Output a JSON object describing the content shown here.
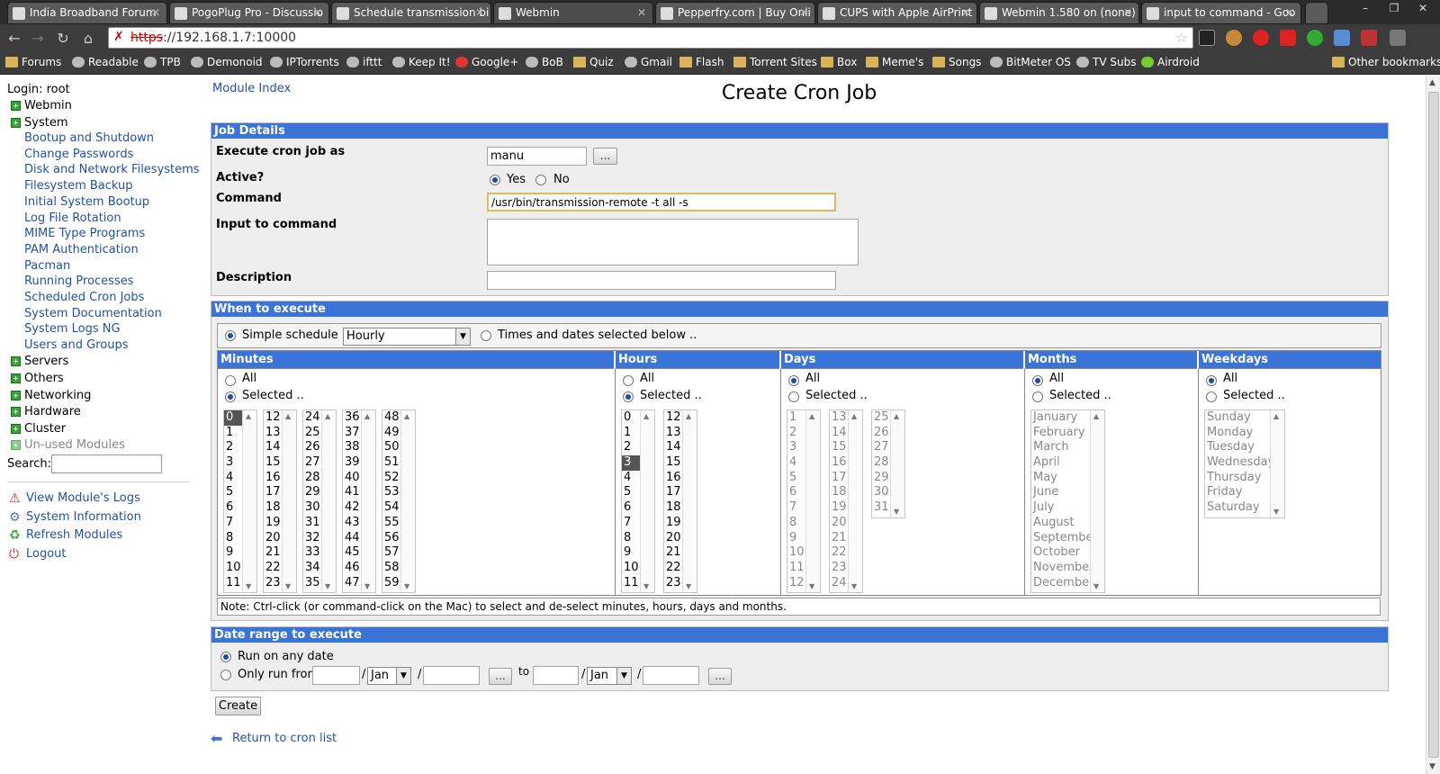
{
  "browser": {
    "tabs": [
      {
        "title": "India Broadband Forum",
        "active": false
      },
      {
        "title": "PogoPlug Pro - Discussio",
        "active": false
      },
      {
        "title": "Schedule transmission bi",
        "active": false
      },
      {
        "title": "Webmin",
        "active": true
      },
      {
        "title": "Pepperfry.com | Buy Onli",
        "active": false
      },
      {
        "title": "CUPS with Apple AirPrint",
        "active": false
      },
      {
        "title": "Webmin 1.580 on (none)",
        "active": false
      },
      {
        "title": "input to command - Goo",
        "active": false
      }
    ],
    "url_scheme": "https",
    "url_rest": "://192.168.1.7:10000",
    "bookmarks": [
      "Forums",
      "Readable",
      "TPB",
      "Demonoid",
      "IPTorrents",
      "ifttt",
      "Keep It!",
      "Google+",
      "BoB",
      "Quiz",
      "Gmail",
      "Flash",
      "Torrent Sites",
      "Box",
      "Meme's",
      "Songs",
      "BitMeter OS",
      "TV Subs",
      "Airdroid"
    ],
    "other_bookmarks": "Other bookmarks"
  },
  "sidebar": {
    "login": "Login: root",
    "categories_top": [
      "Webmin",
      "System"
    ],
    "system_modules": [
      "Bootup and Shutdown",
      "Change Passwords",
      "Disk and Network Filesystems",
      "Filesystem Backup",
      "Initial System Bootup",
      "Log File Rotation",
      "MIME Type Programs",
      "PAM Authentication",
      "Pacman",
      "Running Processes",
      "Scheduled Cron Jobs",
      "System Documentation",
      "System Logs NG",
      "Users and Groups"
    ],
    "categories_bottom": [
      "Servers",
      "Others",
      "Networking",
      "Hardware",
      "Cluster",
      "Un-used Modules"
    ],
    "search_label": "Search:",
    "actions": [
      "View Module's Logs",
      "System Information",
      "Refresh Modules",
      "Logout"
    ]
  },
  "page": {
    "module_index": "Module Index",
    "title": "Create Cron Job",
    "create_button": "Create",
    "return_link": "Return to cron list"
  },
  "job_details": {
    "header": "Job Details",
    "execute_as_label": "Execute cron job as",
    "execute_as_value": "manu",
    "browse_button": "...",
    "active_label": "Active?",
    "active_yes": "Yes",
    "active_no": "No",
    "command_label": "Command",
    "command_value": "/usr/bin/transmission-remote -t all -s",
    "input_label": "Input to command",
    "input_value": "",
    "description_label": "Description",
    "description_value": ""
  },
  "when": {
    "header": "When to execute",
    "simple_label": "Simple schedule ..",
    "simple_value": "Hourly",
    "times_label": "Times and dates selected below ..",
    "all_label": "All",
    "selected_label": "Selected ..",
    "columns": {
      "minutes": "Minutes",
      "hours": "Hours",
      "days": "Days",
      "months": "Months",
      "weekdays": "Weekdays"
    },
    "minutes_lists": [
      [
        "0",
        "1",
        "2",
        "3",
        "4",
        "5",
        "6",
        "7",
        "8",
        "9",
        "10",
        "11"
      ],
      [
        "12",
        "13",
        "14",
        "15",
        "16",
        "17",
        "18",
        "19",
        "20",
        "21",
        "22",
        "23"
      ],
      [
        "24",
        "25",
        "26",
        "27",
        "28",
        "29",
        "30",
        "31",
        "32",
        "33",
        "34",
        "35"
      ],
      [
        "36",
        "37",
        "38",
        "39",
        "40",
        "41",
        "42",
        "43",
        "44",
        "45",
        "46",
        "47"
      ],
      [
        "48",
        "49",
        "50",
        "51",
        "52",
        "53",
        "54",
        "55",
        "56",
        "57",
        "58",
        "59"
      ]
    ],
    "hours_lists": [
      [
        "0",
        "1",
        "2",
        "3",
        "4",
        "5",
        "6",
        "7",
        "8",
        "9",
        "10",
        "11"
      ],
      [
        "12",
        "13",
        "14",
        "15",
        "16",
        "17",
        "18",
        "19",
        "20",
        "21",
        "22",
        "23"
      ]
    ],
    "days_lists": [
      [
        "1",
        "2",
        "3",
        "4",
        "5",
        "6",
        "7",
        "8",
        "9",
        "10",
        "11",
        "12"
      ],
      [
        "13",
        "14",
        "15",
        "16",
        "17",
        "18",
        "19",
        "20",
        "21",
        "22",
        "23",
        "24"
      ],
      [
        "25",
        "26",
        "27",
        "28",
        "29",
        "30",
        "31"
      ]
    ],
    "months_list": [
      "January",
      "February",
      "March",
      "April",
      "May",
      "June",
      "July",
      "August",
      "September",
      "October",
      "November",
      "December"
    ],
    "weekdays_list": [
      "Sunday",
      "Monday",
      "Tuesday",
      "Wednesday",
      "Thursday",
      "Friday",
      "Saturday"
    ],
    "note": "Note: Ctrl-click (or command-click on the Mac) to select and de-select minutes, hours, days and months."
  },
  "date_range": {
    "header": "Date range to execute",
    "any_date": "Run on any date",
    "only_from": "Only run from",
    "month_value": "Jan",
    "to_label": "to",
    "slash": "/",
    "browse": "..."
  },
  "colors": {
    "section_header": "#3a74d8",
    "link": "#2451a6",
    "section_bg": "#eeeeee"
  }
}
